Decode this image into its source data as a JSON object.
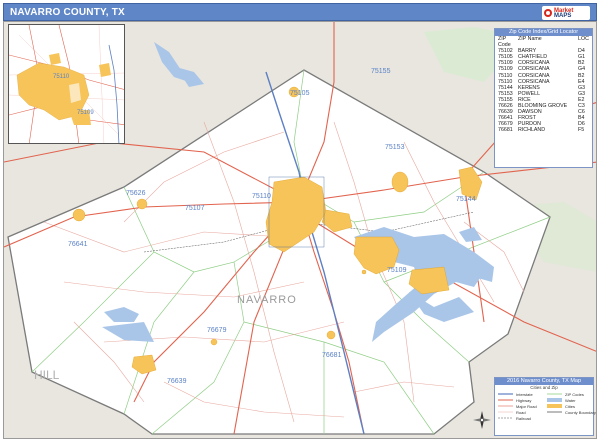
{
  "title": "NAVARRO COUNTY, TX",
  "logo": {
    "line1": "Market",
    "line2": "MAPS"
  },
  "county_label": "NAVARRO",
  "neighbor_labels": [
    {
      "text": "HILL"
    }
  ],
  "zip_labels": [
    {
      "code": "75155"
    },
    {
      "code": "75105"
    },
    {
      "code": "75153"
    },
    {
      "code": "75110"
    },
    {
      "code": "75626"
    },
    {
      "code": "75107"
    },
    {
      "code": "75144"
    },
    {
      "code": "76641"
    },
    {
      "code": "75109"
    },
    {
      "code": "76679"
    },
    {
      "code": "76681"
    },
    {
      "code": "76639"
    },
    {
      "code": "75102"
    }
  ],
  "inset_labels": [
    {
      "text": "75110"
    },
    {
      "text": "75109"
    }
  ],
  "legend": {
    "header": "Zip Code Index/Grid Locator",
    "columns": [
      "ZIP Code",
      "ZIP Name",
      "LOC"
    ],
    "rows": [
      {
        "zip": "75102",
        "name": "BARRY",
        "loc": "D4"
      },
      {
        "zip": "75105",
        "name": "CHATFIELD",
        "loc": "G1"
      },
      {
        "zip": "75109",
        "name": "CORSICANA",
        "loc": "B2"
      },
      {
        "zip": "75109",
        "name": "CORSICANA",
        "loc": "G4"
      },
      {
        "zip": "75110",
        "name": "CORSICANA",
        "loc": "B2"
      },
      {
        "zip": "75110",
        "name": "CORSICANA",
        "loc": "E4"
      },
      {
        "zip": "75144",
        "name": "KERENS",
        "loc": "G3"
      },
      {
        "zip": "75153",
        "name": "POWELL",
        "loc": "G3"
      },
      {
        "zip": "75155",
        "name": "RICE",
        "loc": "E2"
      },
      {
        "zip": "76626",
        "name": "BLOOMING GROVE",
        "loc": "C3"
      },
      {
        "zip": "76639",
        "name": "DAWSON",
        "loc": "C6"
      },
      {
        "zip": "76641",
        "name": "FROST",
        "loc": "B4"
      },
      {
        "zip": "76679",
        "name": "PURDON",
        "loc": "D6"
      },
      {
        "zip": "76681",
        "name": "RICHLAND",
        "loc": "F5"
      }
    ]
  },
  "bottom_legend": {
    "header": "2016 Navarro County, TX Map",
    "subheader": "Cities and Zip",
    "items": [
      "Interstate",
      "Highway",
      "Major Road",
      "Road",
      "Railroad",
      "ZIP Codes",
      "Water",
      "Cities",
      "County Boundary"
    ]
  },
  "colors": {
    "title_bar": "#5f86c7",
    "county_fill": "#ffffff",
    "outside_fill": "#e8e6df",
    "water": "#a9c6e8",
    "city": "#f7c45a",
    "green_area": "#cfe6c4",
    "major_road": "#e2634e",
    "zip_boundary": "#8fce85",
    "zip_label": "#5b82c6",
    "interstate": "#5d7fc4"
  },
  "icons": [
    "compass-rose-icon",
    "logo-icon"
  ]
}
